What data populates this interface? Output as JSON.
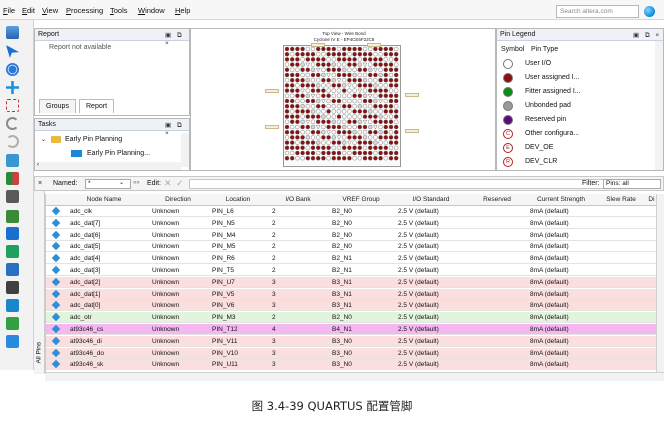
{
  "menu": [
    "File",
    "Edit",
    "View",
    "Processing",
    "Tools",
    "Window",
    "Help"
  ],
  "search": {
    "placeholder": "Search altera.com"
  },
  "report_panel": {
    "title": "Report",
    "message": "Report not available",
    "tabs": [
      "Groups",
      "Report"
    ]
  },
  "tasks_panel": {
    "title": "Tasks",
    "items": [
      {
        "label": "Early Pin Planning",
        "icon": "folder-icon"
      },
      {
        "label": "Early Pin Planning...",
        "icon": "pin-planner-icon"
      }
    ]
  },
  "chip_view": {
    "title": "Top View - Wire Bond",
    "subtitle": "Cyclone IV E - EP4CE6F22C8"
  },
  "legend": {
    "title": "Pin Legend",
    "header_symbol": "Symbol",
    "header_type": "Pin Type",
    "items": [
      {
        "label": "User I/O",
        "color": "#ffffff"
      },
      {
        "label": "User assigned I...",
        "color": "#8b1010"
      },
      {
        "label": "Fitter assigned I...",
        "color": "#0a8a18"
      },
      {
        "label": "Unbonded pad",
        "color": "#9a9a9a"
      },
      {
        "label": "Reserved pin",
        "color": "#5a0b7a"
      },
      {
        "label": "Other configura...",
        "symbol": "C"
      },
      {
        "label": "DEV_OE",
        "symbol": "E"
      },
      {
        "label": "DEV_CLR",
        "symbol": "R"
      }
    ]
  },
  "filterbar": {
    "named_label": "Named:",
    "named_value": "*",
    "edit_label": "Edit:",
    "filter_label": "Filter:",
    "filter_value": "Pins: all"
  },
  "table": {
    "columns": [
      "Node Name",
      "Direction",
      "Location",
      "I/O Bank",
      "VREF Group",
      "I/O Standard",
      "Reserved",
      "Current Strength",
      "Slew Rate",
      "Di"
    ],
    "rows": [
      {
        "name": "adc_clk",
        "dir": "Unknown",
        "loc": "PIN_L6",
        "bank": "2",
        "vref": "B2_N0",
        "std": "2.5 V (default)",
        "res": "",
        "cur": "8mA (default)",
        "hl": "#ffffff"
      },
      {
        "name": "adc_dat[7]",
        "dir": "Unknown",
        "loc": "PIN_N5",
        "bank": "2",
        "vref": "B2_N0",
        "std": "2.5 V (default)",
        "res": "",
        "cur": "8mA (default)",
        "hl": "#ffffff"
      },
      {
        "name": "adc_dat[6]",
        "dir": "Unknown",
        "loc": "PIN_M4",
        "bank": "2",
        "vref": "B2_N0",
        "std": "2.5 V (default)",
        "res": "",
        "cur": "8mA (default)",
        "hl": "#ffffff"
      },
      {
        "name": "adc_dat[5]",
        "dir": "Unknown",
        "loc": "PIN_M5",
        "bank": "2",
        "vref": "B2_N0",
        "std": "2.5 V (default)",
        "res": "",
        "cur": "8mA (default)",
        "hl": "#ffffff"
      },
      {
        "name": "adc_dat[4]",
        "dir": "Unknown",
        "loc": "PIN_R6",
        "bank": "2",
        "vref": "B2_N1",
        "std": "2.5 V (default)",
        "res": "",
        "cur": "8mA (default)",
        "hl": "#ffffff"
      },
      {
        "name": "adc_dat[3]",
        "dir": "Unknown",
        "loc": "PIN_T5",
        "bank": "2",
        "vref": "B2_N1",
        "std": "2.5 V (default)",
        "res": "",
        "cur": "8mA (default)",
        "hl": "#ffffff"
      },
      {
        "name": "adc_dat[2]",
        "dir": "Unknown",
        "loc": "PIN_U7",
        "bank": "3",
        "vref": "B3_N1",
        "std": "2.5 V (default)",
        "res": "",
        "cur": "8mA (default)",
        "hl": "#fbdede"
      },
      {
        "name": "adc_dat[1]",
        "dir": "Unknown",
        "loc": "PIN_V5",
        "bank": "3",
        "vref": "B3_N1",
        "std": "2.5 V (default)",
        "res": "",
        "cur": "8mA (default)",
        "hl": "#fbdede"
      },
      {
        "name": "adc_dat[0]",
        "dir": "Unknown",
        "loc": "PIN_V6",
        "bank": "3",
        "vref": "B3_N1",
        "std": "2.5 V (default)",
        "res": "",
        "cur": "8mA (default)",
        "hl": "#fbdede"
      },
      {
        "name": "adc_otr",
        "dir": "Unknown",
        "loc": "PIN_M3",
        "bank": "2",
        "vref": "B2_N0",
        "std": "2.5 V (default)",
        "res": "",
        "cur": "8mA (default)",
        "hl": "#e2f4dc"
      },
      {
        "name": "at93c46_cs",
        "dir": "Unknown",
        "loc": "PIN_T12",
        "bank": "4",
        "vref": "B4_N1",
        "std": "2.5 V (default)",
        "res": "",
        "cur": "8mA (default)",
        "hl": "#f4b8f0"
      },
      {
        "name": "at93c46_di",
        "dir": "Unknown",
        "loc": "PIN_V11",
        "bank": "3",
        "vref": "B3_N0",
        "std": "2.5 V (default)",
        "res": "",
        "cur": "8mA (default)",
        "hl": "#fbdede"
      },
      {
        "name": "at93c46_do",
        "dir": "Unknown",
        "loc": "PIN_V10",
        "bank": "3",
        "vref": "B3_N0",
        "std": "2.5 V (default)",
        "res": "",
        "cur": "8mA (default)",
        "hl": "#fbdede"
      },
      {
        "name": "at93c46_sk",
        "dir": "Unknown",
        "loc": "PIN_U11",
        "bank": "3",
        "vref": "B3_N0",
        "std": "2.5 V (default)",
        "res": "",
        "cur": "8mA (default)",
        "hl": "#fbdede"
      }
    ]
  },
  "all_pins_tab": "All Pins",
  "caption": "图 3.4-39 QUARTUS 配置管脚",
  "colors": {
    "accent": "#0a88d8",
    "pin_icon": "#2d8fd8"
  }
}
